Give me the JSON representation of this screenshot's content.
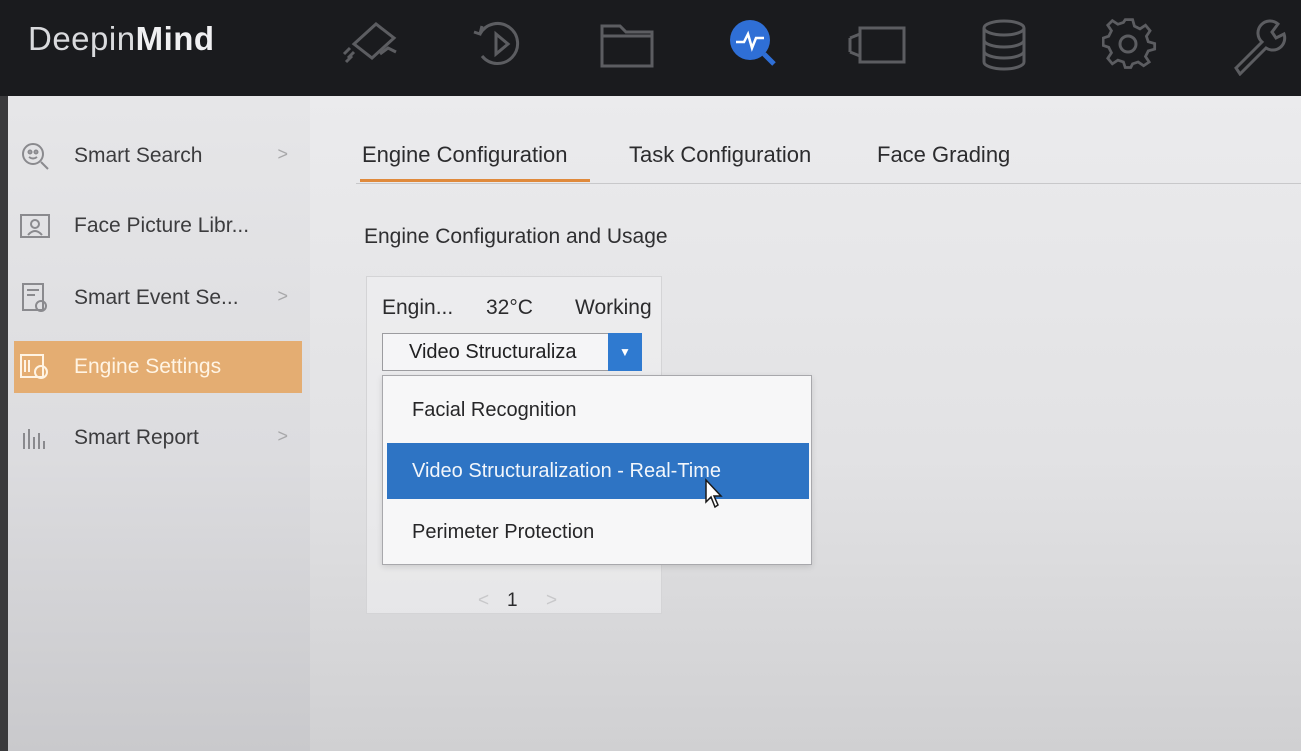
{
  "app": {
    "brand_regular": "Deepin",
    "brand_bold": "Mind"
  },
  "topnav": {
    "icons": [
      "camera-icon",
      "playback-icon",
      "folder-icon",
      "smart-analysis-icon",
      "video-wall-icon",
      "storage-icon",
      "settings-icon",
      "maintenance-icon"
    ],
    "active": "smart-analysis-icon",
    "active_color": "#2f6fd6"
  },
  "sidebar": {
    "items": [
      {
        "label": "Smart Search",
        "icon": "face-search-icon",
        "has_chevron": true
      },
      {
        "label": "Face Picture Libr...",
        "icon": "face-library-icon",
        "has_chevron": false
      },
      {
        "label": "Smart Event Se...",
        "icon": "event-settings-icon",
        "has_chevron": true
      },
      {
        "label": "Engine Settings",
        "icon": "engine-settings-icon",
        "has_chevron": false,
        "active": true
      },
      {
        "label": "Smart Report",
        "icon": "bar-chart-icon",
        "has_chevron": true
      }
    ],
    "chevron": ">",
    "active_color": "#e4ad72"
  },
  "tabs": [
    {
      "label": "Engine Configuration",
      "active": true
    },
    {
      "label": "Task Configuration",
      "active": false
    },
    {
      "label": "Face Grading",
      "active": false
    }
  ],
  "section": {
    "title": "Engine Configuration and Usage"
  },
  "engine": {
    "name": "Engin...",
    "temperature": "32°C",
    "status": "Working",
    "select_value": "Video Structuraliza",
    "options": [
      "Facial Recognition",
      "Video Structuralization - Real-Time",
      "Perimeter Protection"
    ],
    "selected_option": "Video Structuralization - Real-Time"
  },
  "pagination": {
    "prev": "<",
    "page": "1",
    "next": ">"
  },
  "colors": {
    "accent": "#e08a3c",
    "select_blue": "#2e74c4",
    "topbar": "#1a1b1e"
  }
}
